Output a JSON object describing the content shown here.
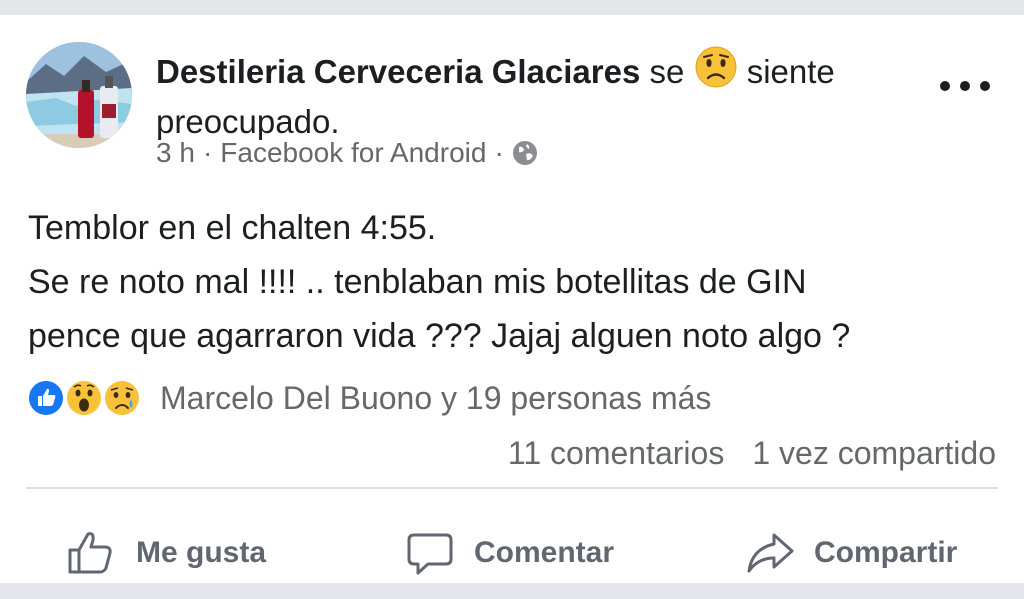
{
  "post": {
    "author": "Destileria Cerveceria Glaciares",
    "feeling_prefix": "se",
    "feeling_emoji": "worried-face",
    "feeling_text_1": "siente",
    "feeling_text_2": "preocupado.",
    "time": "3 h",
    "separator": "·",
    "source": "Facebook for Android",
    "privacy_icon": "globe-icon",
    "lines": [
      "Temblor en el chalten 4:55.",
      "Se re noto mal !!!! .. tenblaban mis botellitas de GIN",
      "pence que agarraron vida ??? Jajaj alguen noto algo ?"
    ]
  },
  "reactions": {
    "icons": [
      "like-icon",
      "wow-icon",
      "sad-icon"
    ],
    "summary": "Marcelo Del Buono y 19 personas más",
    "comments": "11 comentarios",
    "shares": "1 vez compartido"
  },
  "actions": {
    "like": "Me gusta",
    "comment": "Comentar",
    "share": "Compartir"
  },
  "colors": {
    "facebook_blue": "#1877f2",
    "emoji_yellow": "#f7c23a",
    "text": "#1c1e21",
    "muted": "#65676b"
  }
}
